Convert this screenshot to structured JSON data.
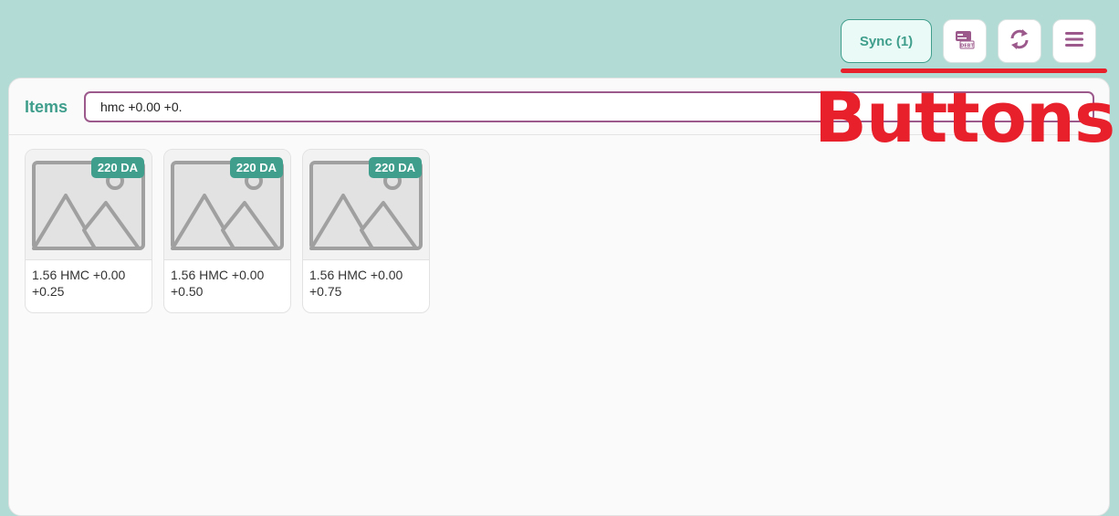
{
  "toolbar": {
    "sync_label": "Sync (1)",
    "debt_icon": "debt-card-icon",
    "refresh_icon": "refresh-icon",
    "menu_icon": "menu-icon",
    "accent_color": "#3f9e8c",
    "icon_color": "#9c5a8c"
  },
  "annotation": {
    "text": "Buttons",
    "color": "#e8202c"
  },
  "header": {
    "title": "Items",
    "search_value": "hmc +0.00 +0."
  },
  "items": [
    {
      "price": "220 DA",
      "name": "1.56 HMC +0.00 +0.25"
    },
    {
      "price": "220 DA",
      "name": "1.56 HMC +0.00 +0.50"
    },
    {
      "price": "220 DA",
      "name": "1.56 HMC +0.00 +0.75"
    }
  ]
}
